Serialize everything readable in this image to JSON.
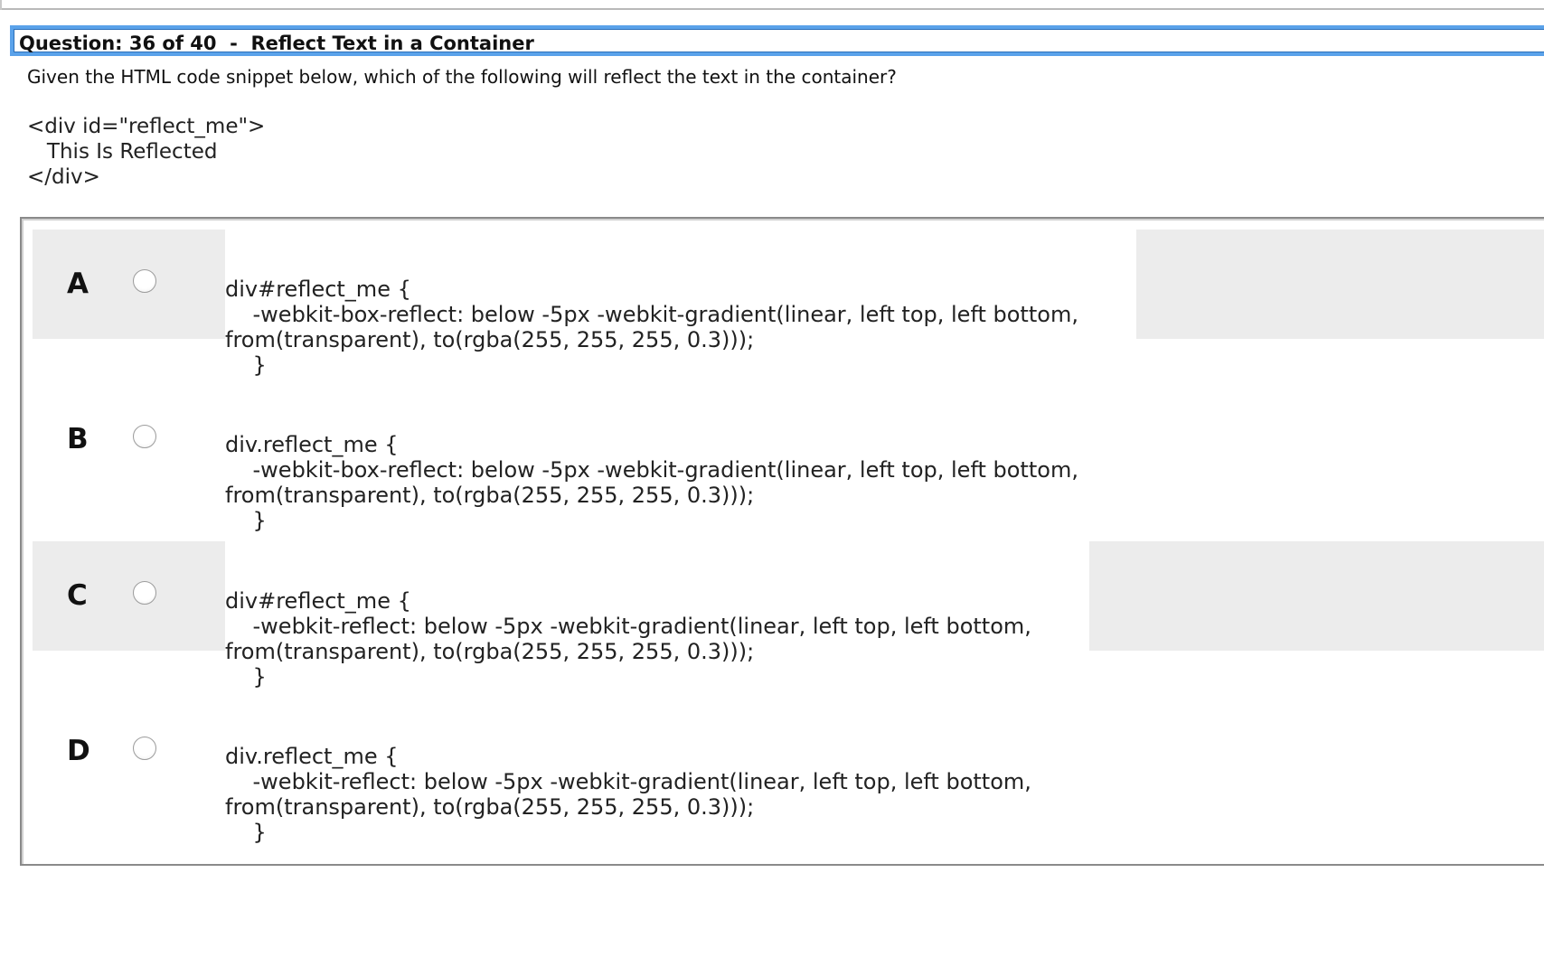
{
  "question": {
    "title": "Question: 36 of 40  -  Reflect Text in a Container",
    "prompt": "Given the HTML code snippet below, which of the following will reflect the text in the container?",
    "snippet": "<div id=\"reflect_me\">\n   This Is Reflected\n</div>"
  },
  "answers": [
    {
      "letter": "A",
      "code": "div#reflect_me {\n    -webkit-box-reflect: below -5px -webkit-gradient(linear, left top, left bottom,\nfrom(transparent), to(rgba(255, 255, 255, 0.3)));\n    }"
    },
    {
      "letter": "B",
      "code": "div.reflect_me {\n    -webkit-box-reflect: below -5px -webkit-gradient(linear, left top, left bottom,\nfrom(transparent), to(rgba(255, 255, 255, 0.3)));\n    }"
    },
    {
      "letter": "C",
      "code": "div#reflect_me {\n    -webkit-reflect: below -5px -webkit-gradient(linear, left top, left bottom,\nfrom(transparent), to(rgba(255, 255, 255, 0.3)));\n    }"
    },
    {
      "letter": "D",
      "code": "div.reflect_me {\n    -webkit-reflect: below -5px -webkit-gradient(linear, left top, left bottom,\nfrom(transparent), to(rgba(255, 255, 255, 0.3)));\n    }"
    }
  ],
  "colors": {
    "header_border": "#5aa2ea",
    "shaded_row": "#ececec"
  }
}
